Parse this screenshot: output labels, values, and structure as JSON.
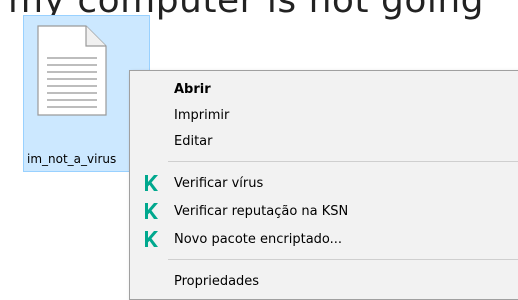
{
  "desktop": {
    "top_text": "my computer is not going"
  },
  "file": {
    "name": "im_not_a_virus",
    "icon": "text-document-icon"
  },
  "context_menu": {
    "items": [
      {
        "label": "Abrir",
        "bold": true
      },
      {
        "label": "Imprimir"
      },
      {
        "label": "Editar"
      },
      {
        "label": "Verificar vírus",
        "icon": "kaspersky-k-icon"
      },
      {
        "label": "Verificar reputação na KSN",
        "icon": "kaspersky-k-icon"
      },
      {
        "label": "Novo pacote encriptado...",
        "icon": "kaspersky-k-icon"
      },
      {
        "label": "Propriedades"
      }
    ],
    "colors": {
      "kaspersky_green": "#00a88e",
      "selection_bg": "#cce8ff",
      "menu_bg": "#f2f2f2"
    }
  }
}
